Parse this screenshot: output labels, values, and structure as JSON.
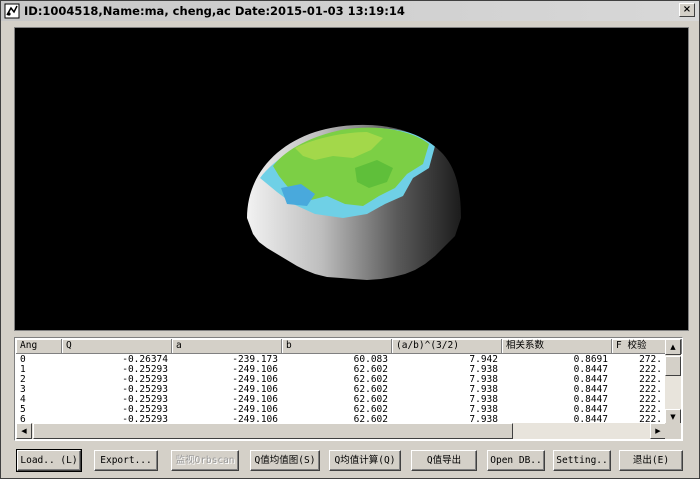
{
  "window": {
    "title": "ID:1004518,Name:ma, cheng,ac Date:2015-01-03 13:19:14",
    "close_label": "×"
  },
  "grid": {
    "columns": [
      "Ang",
      "Q",
      "a",
      "b",
      "(a/b)^(3/2)",
      "相关系数",
      "F 校验"
    ],
    "rows": [
      [
        "0",
        "-0.26374",
        "-239.173",
        "60.083",
        "7.942",
        "0.8691",
        "272."
      ],
      [
        "1",
        "-0.25293",
        "-249.106",
        "62.602",
        "7.938",
        "0.8447",
        "222."
      ],
      [
        "2",
        "-0.25293",
        "-249.106",
        "62.602",
        "7.938",
        "0.8447",
        "222."
      ],
      [
        "3",
        "-0.25293",
        "-249.106",
        "62.602",
        "7.938",
        "0.8447",
        "222."
      ],
      [
        "4",
        "-0.25293",
        "-249.106",
        "62.602",
        "7.938",
        "0.8447",
        "222."
      ],
      [
        "5",
        "-0.25293",
        "-249.106",
        "62.602",
        "7.938",
        "0.8447",
        "222."
      ],
      [
        "6",
        "-0.25293",
        "-249.106",
        "62.602",
        "7.938",
        "0.8447",
        "222."
      ]
    ]
  },
  "buttons": {
    "load": "Load.. (L)",
    "export": "Export...",
    "orbscan": "监视Orbscan",
    "q_mean_chart": "Q值均值图(S)",
    "q_mean_calc": "Q均值计算(Q)",
    "q_export": "Q值导出",
    "open_db": "Open DB..",
    "setting": "Setting..",
    "exit": "退出(E)"
  },
  "icons": {
    "app": "app-icon",
    "close": "close-icon",
    "scroll_up": "arrow-up-icon",
    "scroll_down": "arrow-down-icon",
    "scroll_left": "arrow-left-icon",
    "scroll_right": "arrow-right-icon"
  },
  "colors": {
    "viewport_bg": "#000000",
    "map_green": "#7ccf45",
    "map_cyan": "#6fd0e6",
    "shell_light": "#f2f2f2",
    "shell_dark": "#1c1c1c"
  }
}
